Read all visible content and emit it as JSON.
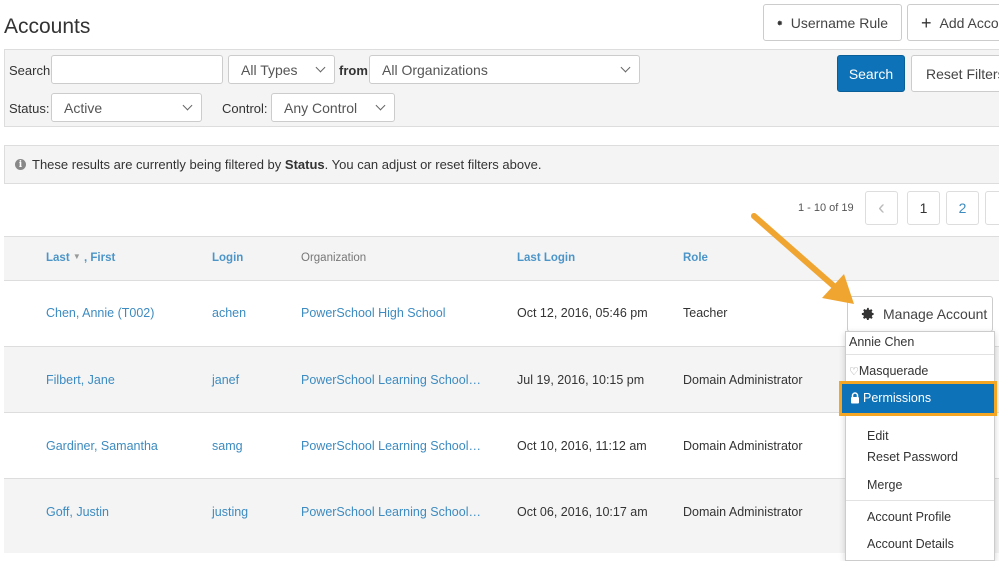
{
  "header": {
    "title": "Accounts",
    "username_rule_label": "Username Rule",
    "add_account_label": "Add Account"
  },
  "filters": {
    "search_label": "Search",
    "search_value": "",
    "type_value": "All Types",
    "from_label": "from",
    "org_value": "All Organizations",
    "status_label": "Status:",
    "status_value": "Active",
    "control_label": "Control:",
    "control_value": "Any Control",
    "search_button": "Search",
    "reset_button": "Reset Filters"
  },
  "info": {
    "prefix": "These results are currently being filtered by ",
    "filter_name": "Status",
    "suffix": ". You can adjust or reset filters above."
  },
  "pagination": {
    "range": "1 - 10 of 19",
    "prev": "‹",
    "pages": [
      "1",
      "2"
    ]
  },
  "table": {
    "columns": {
      "name_last": "Last",
      "sort_glyph": "▼",
      "name_first": ", First",
      "login": "Login",
      "organization": "Organization",
      "last_login": "Last Login",
      "role": "Role"
    },
    "rows": [
      {
        "name": "Chen, Annie (T002)",
        "login": "achen",
        "org": "PowerSchool High School",
        "last_login": "Oct 12, 2016, 05:46 pm",
        "role": "Teacher"
      },
      {
        "name": "Filbert, Jane",
        "login": "janef",
        "org": "PowerSchool Learning School…",
        "last_login": "Jul 19, 2016, 10:15 pm",
        "role": "Domain Administrator"
      },
      {
        "name": "Gardiner, Samantha",
        "login": "samg",
        "org": "PowerSchool Learning School…",
        "last_login": "Oct 10, 2016, 11:12 am",
        "role": "Domain Administrator"
      },
      {
        "name": "Goff, Justin",
        "login": "justing",
        "org": "PowerSchool Learning School…",
        "last_login": "Oct 06, 2016, 10:17 am",
        "role": "Domain Administrator"
      }
    ]
  },
  "manage": {
    "button": "Manage Account",
    "menu_title": "Annie Chen",
    "items": {
      "masquerade": "Masquerade",
      "permissions": "Permissions",
      "edit": "Edit",
      "reset_password": "Reset Password",
      "merge": "Merge",
      "account_profile": "Account Profile",
      "account_details": "Account Details"
    }
  },
  "colors": {
    "primary": "#0d72b8",
    "link": "#3d8bc0",
    "highlight": "#f5a623",
    "arrow": "#f0a531"
  },
  "icons": [
    "gear-icon",
    "plus-icon",
    "chevron-down-icon",
    "info-icon",
    "sort-down-icon",
    "gem-icon",
    "lock-icon",
    "arrow-annotation"
  ]
}
